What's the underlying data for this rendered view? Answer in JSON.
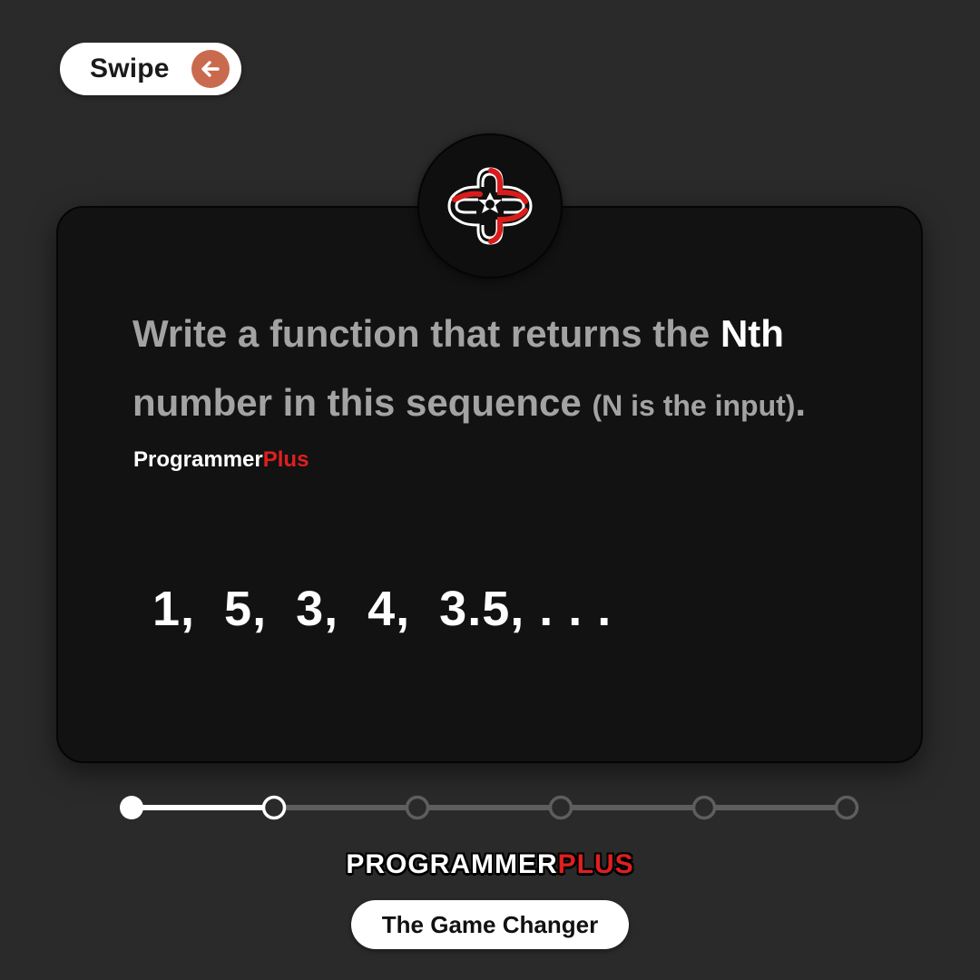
{
  "swipe": {
    "label": "Swipe",
    "icon": "arrow-left-icon",
    "accent": "#c96a4e"
  },
  "card": {
    "question": {
      "part1": "Write a function that returns the ",
      "highlight": "Nth",
      "part2": " number in this sequence ",
      "note": "(N is the input)",
      "end": "."
    },
    "brand": {
      "word1": "Programmer",
      "word2": "Plus"
    },
    "sequence": "1,  5,  3,  4,  3.5, . . ."
  },
  "progress": {
    "total_steps": 6,
    "current_step": 2,
    "completed_color": "#ffffff",
    "pending_color": "#5e5e5e"
  },
  "footer": {
    "brand_word1": "Programmer",
    "brand_word2": "Plus",
    "tagline": "The Game Changer"
  },
  "colors": {
    "background": "#2a2a2a",
    "card": "#121212",
    "brand_red": "#e01f1f",
    "muted_text": "#a3a3a3"
  }
}
